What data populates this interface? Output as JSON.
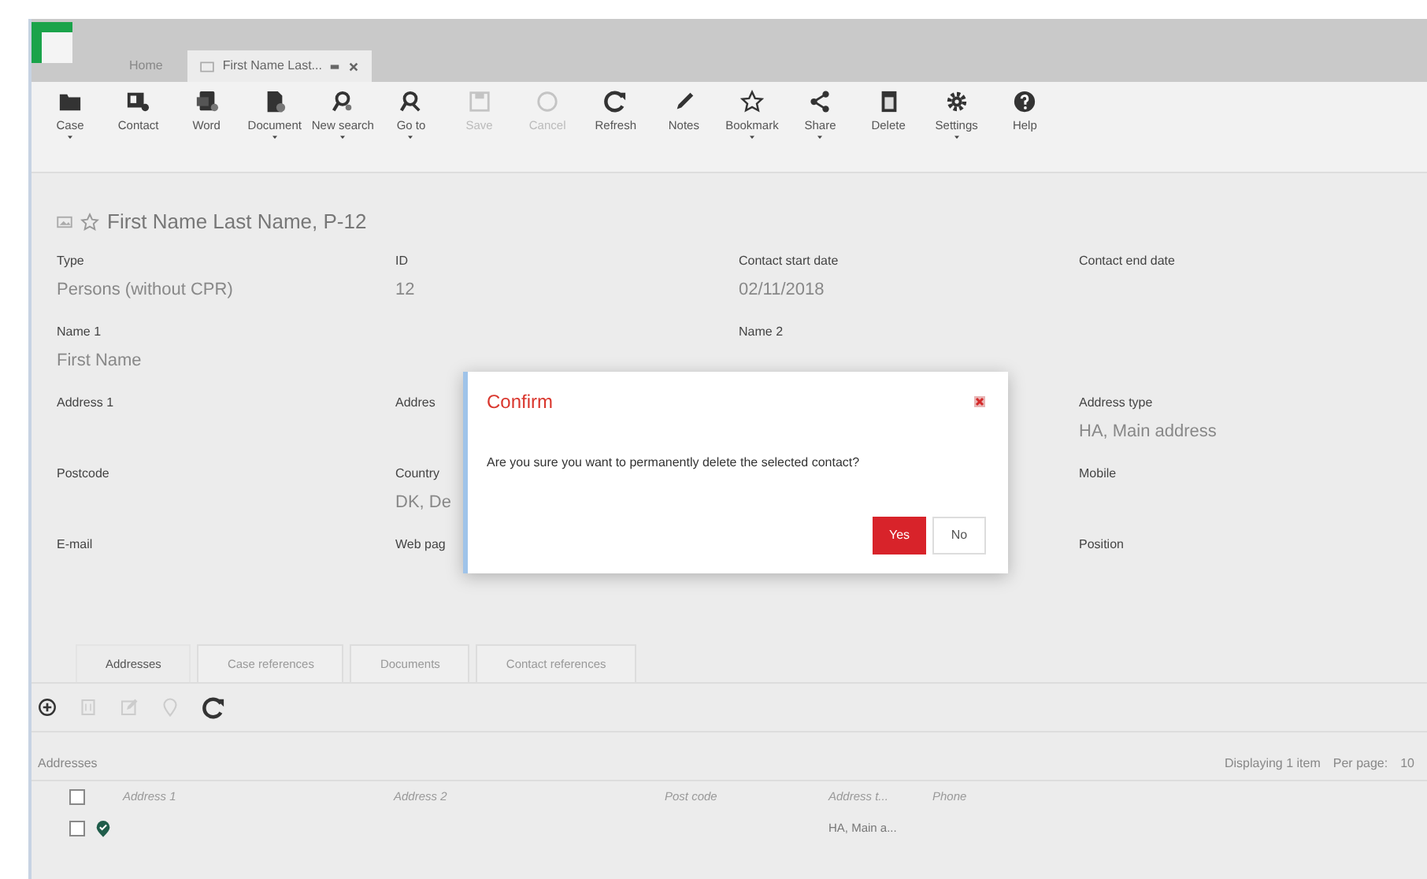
{
  "app_tabs": [
    {
      "label": "Home",
      "selected": false
    },
    {
      "label": "First Name Last...",
      "selected": true
    }
  ],
  "toolbar": [
    {
      "label": "Case",
      "dropdown": true,
      "disabled": false
    },
    {
      "label": "Contact",
      "dropdown": false,
      "disabled": false
    },
    {
      "label": "Word",
      "dropdown": false,
      "disabled": false
    },
    {
      "label": "Document",
      "dropdown": true,
      "disabled": false
    },
    {
      "label": "New search",
      "dropdown": true,
      "disabled": false
    },
    {
      "label": "Go to",
      "dropdown": true,
      "disabled": false
    },
    {
      "label": "Save",
      "dropdown": false,
      "disabled": true
    },
    {
      "label": "Cancel",
      "dropdown": false,
      "disabled": true
    },
    {
      "label": "Refresh",
      "dropdown": false,
      "disabled": false
    },
    {
      "label": "Notes",
      "dropdown": false,
      "disabled": false
    },
    {
      "label": "Bookmark",
      "dropdown": true,
      "disabled": false
    },
    {
      "label": "Share",
      "dropdown": true,
      "disabled": false
    },
    {
      "label": "Delete",
      "dropdown": false,
      "disabled": false
    },
    {
      "label": "Settings",
      "dropdown": true,
      "disabled": false
    },
    {
      "label": "Help",
      "dropdown": false,
      "disabled": false
    }
  ],
  "record": {
    "title": "First Name Last Name, P-12",
    "fields": [
      {
        "column_1": {
          "label": "Type",
          "value": "Persons (without CPR)"
        },
        "column_2": {
          "label": "ID",
          "value": "12"
        },
        "column_3": {
          "label": "Contact start date",
          "value": "02/11/2018"
        },
        "column_4": {
          "label": "Contact end date"
        }
      },
      {
        "column_1": {
          "label": "Name 1",
          "value": "First Name"
        },
        "column_3": {
          "label": "Name 2"
        }
      },
      {
        "column_1": {
          "label": "Address 1"
        },
        "column_2": {
          "label": "Addres"
        },
        "column_4": {
          "label": "Address type",
          "value": "HA, Main address"
        }
      },
      {
        "column_1": {
          "label": "Postcode"
        },
        "column_2": {
          "label": "Country",
          "value": "DK, De"
        },
        "column_4": {
          "label": "Mobile"
        }
      },
      {
        "column_1": {
          "label": "E-mail"
        },
        "column_2": {
          "label": "Web pag"
        },
        "column_4": {
          "label": "Position"
        }
      }
    ]
  },
  "detail_tabs": [
    {
      "label": "Addresses",
      "selected": true
    },
    {
      "label": "Case references",
      "selected": false
    },
    {
      "label": "Documents",
      "selected": false
    },
    {
      "label": "Contact references",
      "selected": false
    }
  ],
  "sub_toolbar": [
    {
      "disabled": false
    },
    {
      "disabled": true
    },
    {
      "disabled": true
    },
    {
      "disabled": true
    },
    {
      "disabled": false
    }
  ],
  "addresses": {
    "title": "Addresses",
    "select_all_checked": false,
    "displaying": "Displaying 1 item",
    "per_page_label": "Per page:",
    "per_page": "10",
    "columns": [
      "Address 1",
      "Address 2",
      "Post code",
      "Address t...",
      "Phone"
    ],
    "rows": [
      {
        "checked": false,
        "cells": [
          "",
          "",
          "",
          "HA, Main a...",
          ""
        ]
      }
    ]
  },
  "dialog": {
    "title": "Confirm",
    "message": "Are you sure you want to permanently delete the selected contact?",
    "buttons": [
      {
        "label": "Yes",
        "primary": true
      },
      {
        "label": "No",
        "primary": false
      }
    ]
  }
}
